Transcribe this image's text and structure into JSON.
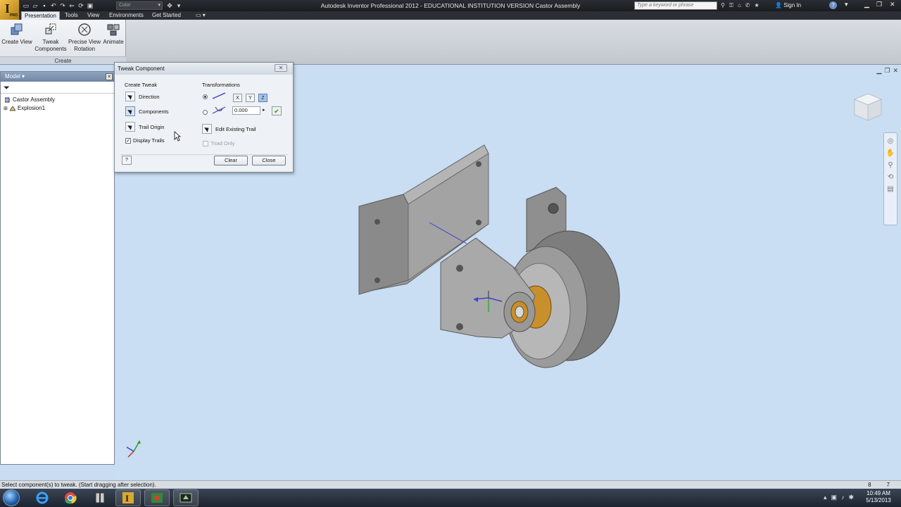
{
  "window": {
    "title": "Autodesk Inventor Professional 2012 - EDUCATIONAL INSTITUTION VERSION   Castor Assembly",
    "app_logo_letter": "I",
    "app_logo_badge": "PRO",
    "color_combo": "Color",
    "search_placeholder": "Type a keyword or phrase",
    "sign_in": "Sign In"
  },
  "tabs": [
    {
      "label": "Presentation",
      "active": true
    },
    {
      "label": "Tools",
      "active": false
    },
    {
      "label": "View",
      "active": false
    },
    {
      "label": "Environments",
      "active": false
    },
    {
      "label": "Get Started",
      "active": false
    }
  ],
  "ribbon": {
    "buttons": [
      {
        "line1": "Create View",
        "line2": ""
      },
      {
        "line1": "Tweak",
        "line2": "Components"
      },
      {
        "line1": "Precise View",
        "line2": "Rotation"
      },
      {
        "line1": "Animate",
        "line2": ""
      }
    ],
    "panel_label": "Create"
  },
  "browser": {
    "header": "Model",
    "items": [
      "Castor Assembly",
      "Explosion1"
    ]
  },
  "dialog": {
    "title": "Tweak Component",
    "create_tweak_label": "Create Tweak",
    "create_items": [
      "Direction",
      "Components",
      "Trail Origin"
    ],
    "display_trails": "Display Trails",
    "display_trails_checked": true,
    "transformations_label": "Transformations",
    "axes": [
      "X",
      "Y",
      "Z"
    ],
    "active_axis": "Z",
    "rotation_value": "0.000",
    "edit_existing_trail": "Edit Existing Trail",
    "triad_only": "Triad Only",
    "clear_label": "Clear",
    "close_label": "Close"
  },
  "status": {
    "message": "Select component(s) to tweak. (Start dragging after selection).",
    "num1": "8",
    "num2": "7"
  },
  "clock": {
    "time": "10:49 AM",
    "date": "5/13/2013"
  },
  "colors": {
    "viewport_bg": "#c9ddf3",
    "part_gray": "#8e8e8e",
    "bushing_gold": "#c8902c",
    "axis_active": "#a7c4ea"
  }
}
